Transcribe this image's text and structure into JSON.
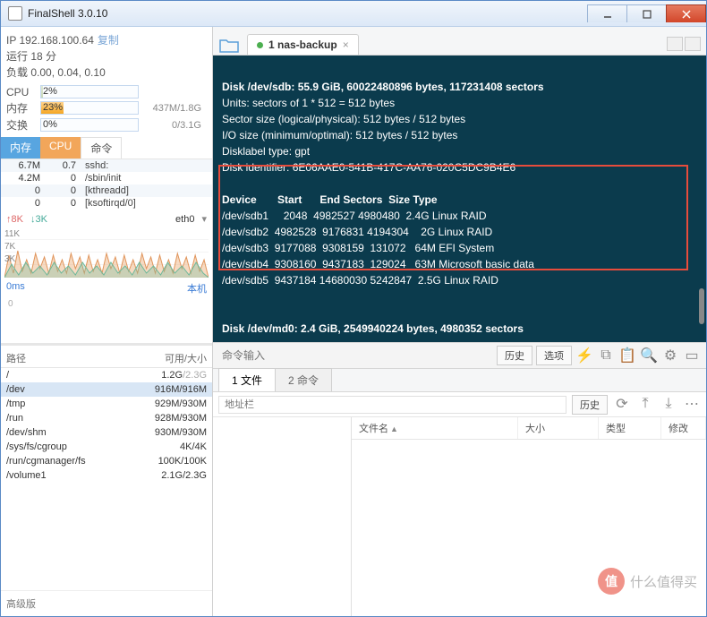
{
  "titlebar": {
    "title": "FinalShell 3.0.10"
  },
  "left": {
    "ip_label": "IP",
    "ip": "192.168.100.64",
    "copy": "复制",
    "uptime": "运行 18 分",
    "load": "负载 0.00, 0.04, 0.10",
    "cpu_label": "CPU",
    "cpu_pct": "2%",
    "mem_label": "内存",
    "mem_pct": "23%",
    "mem_detail": "437M/1.8G",
    "swap_label": "交换",
    "swap_pct": "0%",
    "swap_detail": "0/3.1G",
    "tabs": {
      "mem": "内存",
      "cpu": "CPU",
      "cmd": "命令"
    },
    "procs": [
      {
        "m": "6.7M",
        "c": "0.7",
        "n": "sshd:"
      },
      {
        "m": "4.2M",
        "c": "0",
        "n": "/sbin/init"
      },
      {
        "m": "0",
        "c": "0",
        "n": "[kthreadd]"
      },
      {
        "m": "0",
        "c": "0",
        "n": "[ksoftirqd/0]"
      }
    ],
    "net": {
      "up": "↑8K",
      "down": "↓3K",
      "iface": "eth0",
      "y1": "11K",
      "y2": "7K",
      "y3": "3K"
    },
    "ping": {
      "left": "0ms",
      "right": "本机",
      "y0": "0"
    },
    "fs_hdr_path": "路径",
    "fs_hdr_size": "可用/大小",
    "fs": [
      {
        "p": "/",
        "s": "1.2G/2.3G",
        "gray": true
      },
      {
        "p": "/dev",
        "s": "916M/916M",
        "sel": true
      },
      {
        "p": "/tmp",
        "s": "929M/930M"
      },
      {
        "p": "/run",
        "s": "928M/930M"
      },
      {
        "p": "/dev/shm",
        "s": "930M/930M"
      },
      {
        "p": "/sys/fs/cgroup",
        "s": "4K/4K"
      },
      {
        "p": "/run/cgmanager/fs",
        "s": "100K/100K"
      },
      {
        "p": "/volume1",
        "s": "2.1G/2.3G"
      }
    ],
    "footer": "高级版"
  },
  "right": {
    "tab_label": "1 nas-backup",
    "terminal_lines": [
      "Disk /dev/sdb: 55.9 GiB, 60022480896 bytes, 117231408 sectors",
      "Units: sectors of 1 * 512 = 512 bytes",
      "Sector size (logical/physical): 512 bytes / 512 bytes",
      "I/O size (minimum/optimal): 512 bytes / 512 bytes",
      "Disklabel type: gpt",
      "Disk identifier: 6E06AAE0-541B-417C-AA76-020C5DC9B4E6",
      "",
      "Device       Start      End Sectors  Size Type",
      "/dev/sdb1     2048  4982527 4980480  2.4G Linux RAID",
      "/dev/sdb2  4982528  9176831 4194304    2G Linux RAID",
      "/dev/sdb3  9177088  9308159  131072   64M EFI System",
      "/dev/sdb4  9308160  9437183  129024   63M Microsoft basic data",
      "/dev/sdb5  9437184 14680030 5242847  2.5G Linux RAID",
      "",
      "",
      "Disk /dev/md0: 2.4 GiB, 2549940224 bytes, 4980352 sectors"
    ],
    "cmd_placeholder": "命令输入",
    "history_btn": "历史",
    "options_btn": "选项",
    "filetab1": "1 文件",
    "filetab2": "2 命令",
    "addr_placeholder": "地址栏",
    "history2": "历史",
    "col_name": "文件名",
    "col_size": "大小",
    "col_type": "类型",
    "col_mod": "修改"
  },
  "watermark": {
    "icon": "值",
    "text": "什么值得买"
  }
}
